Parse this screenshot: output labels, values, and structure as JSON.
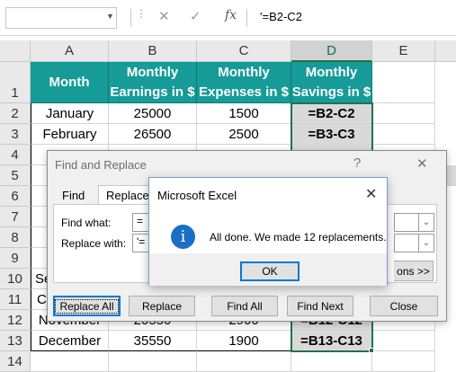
{
  "formula_bar": {
    "name_box": "",
    "cancel_glyph": "✕",
    "enter_glyph": "✓",
    "fx_label": "fx",
    "formula": "'=B2-C2"
  },
  "columns": [
    "A",
    "B",
    "C",
    "D",
    "E"
  ],
  "rows": [
    "1",
    "2",
    "3",
    "4",
    "5",
    "6",
    "7",
    "8",
    "9",
    "10",
    "11",
    "12",
    "13",
    "14"
  ],
  "table": {
    "headers": [
      [
        "Month"
      ],
      [
        "Monthly",
        "Earnings in $"
      ],
      [
        "Monthly",
        "Expenses in $"
      ],
      [
        "Monthly",
        "Savings in $"
      ]
    ],
    "visible_rows": {
      "r2": [
        "January",
        "25000",
        "1500",
        "=B2-C2"
      ],
      "r3": [
        "February",
        "26500",
        "2500",
        "=B3-C3"
      ],
      "r10": [
        "Se"
      ],
      "r11": [
        "C"
      ],
      "r12": [
        "November",
        "20550",
        "2900",
        "=B12-C12"
      ],
      "r13": [
        "December",
        "35550",
        "1900",
        "=B13-C13"
      ]
    }
  },
  "find_replace": {
    "title": "Find and Replace",
    "help_glyph": "?",
    "close_glyph": "✕",
    "tabs": [
      "Find",
      "Replace"
    ],
    "find_label": "Find what:",
    "find_value": "=",
    "replace_label": "Replace with:",
    "replace_value": "'=",
    "options_label": "ons >>",
    "buttons": {
      "replace_all": "Replace All",
      "replace": "Replace",
      "find_all": "Find All",
      "find_next": "Find Next",
      "close": "Close"
    }
  },
  "message_box": {
    "title": "Microsoft Excel",
    "close_glyph": "✕",
    "icon": "info-icon",
    "icon_glyph": "i",
    "message": "All done. We made 12 replacements.",
    "ok_label": "OK"
  },
  "colors": {
    "header_teal": "#169b98",
    "excel_green": "#217346",
    "accent_blue": "#0078d7",
    "info_blue": "#1a6fc4"
  }
}
